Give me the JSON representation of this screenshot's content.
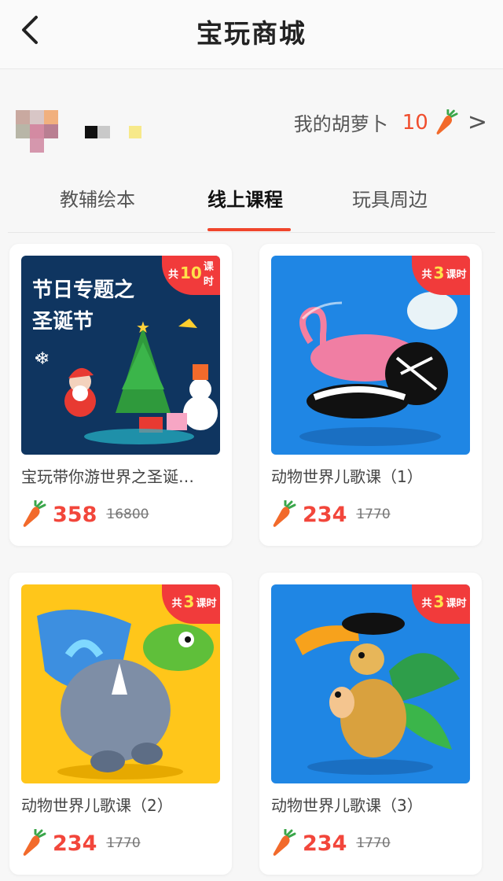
{
  "header": {
    "title": "宝玩商城"
  },
  "user": {
    "carrot_label": "我的胡萝卜",
    "carrot_count": "10",
    "chevron": ">"
  },
  "tabs": [
    {
      "label": "教辅绘本",
      "active": false
    },
    {
      "label": "线上课程",
      "active": true
    },
    {
      "label": "玩具周边",
      "active": false
    }
  ],
  "products": [
    {
      "badge_prefix": "共",
      "badge_num": "10",
      "badge_suffix": "课时",
      "thumb_title_line1": "节日专题之",
      "thumb_title_line2": "圣诞节",
      "name": "宝玩带你游世界之圣诞…",
      "price": "358",
      "original_price": "16800"
    },
    {
      "badge_prefix": "共",
      "badge_num": "3",
      "badge_suffix": "课时",
      "name": "动物世界儿歌课（1）",
      "price": "234",
      "original_price": "1770"
    },
    {
      "badge_prefix": "共",
      "badge_num": "3",
      "badge_suffix": "课时",
      "name": "动物世界儿歌课（2）",
      "price": "234",
      "original_price": "1770"
    },
    {
      "badge_prefix": "共",
      "badge_num": "3",
      "badge_suffix": "课时",
      "name": "动物世界儿歌课（3）",
      "price": "234",
      "original_price": "1770"
    }
  ],
  "colors": {
    "accent": "#f0462c",
    "price": "#f2463b",
    "badge": "#f13b3b",
    "blue_bg": "#1f86e4",
    "yellow_bg": "#ffc61a",
    "navy_bg": "#0f3560"
  },
  "icons": {
    "back": "chevron-left-icon",
    "carrot": "carrot-icon"
  }
}
